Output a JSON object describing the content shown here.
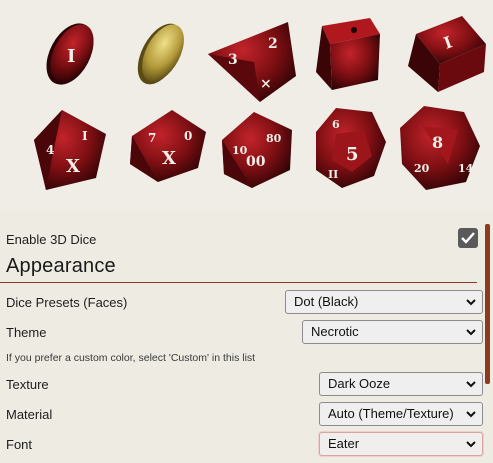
{
  "preview": {
    "dice": [
      {
        "name": "d2-coin-dark-die",
        "face": "I"
      },
      {
        "name": "d2-coin-gold-die",
        "face": ""
      },
      {
        "name": "d4-die",
        "face": "3"
      },
      {
        "name": "d6-die",
        "face": ""
      },
      {
        "name": "d6-numbered-die",
        "face": "I"
      },
      {
        "name": "d8-die",
        "face": "X"
      },
      {
        "name": "d10-die",
        "face": "X"
      },
      {
        "name": "d10-percentile-die",
        "face": "00"
      },
      {
        "name": "d12-die",
        "face": "5"
      },
      {
        "name": "d20-die",
        "face": "8"
      }
    ]
  },
  "settings": {
    "enable_3d_label": "Enable 3D Dice",
    "enable_3d_checked": true,
    "section_title": "Appearance",
    "dice_presets_label": "Dice Presets (Faces)",
    "dice_presets_value": "Dot (Black)",
    "theme_label": "Theme",
    "theme_value": "Necrotic",
    "theme_note": "If you prefer a custom color, select 'Custom' in this list",
    "texture_label": "Texture",
    "texture_value": "Dark Ooze",
    "material_label": "Material",
    "material_value": "Auto (Theme/Texture)",
    "font_label": "Font",
    "font_value": "Eater"
  },
  "colors": {
    "dice_red": "#8e1418",
    "dice_dark": "#3a0608",
    "accent_rule": "#8b3a2a",
    "scrollbar": "#8c3b1c"
  }
}
